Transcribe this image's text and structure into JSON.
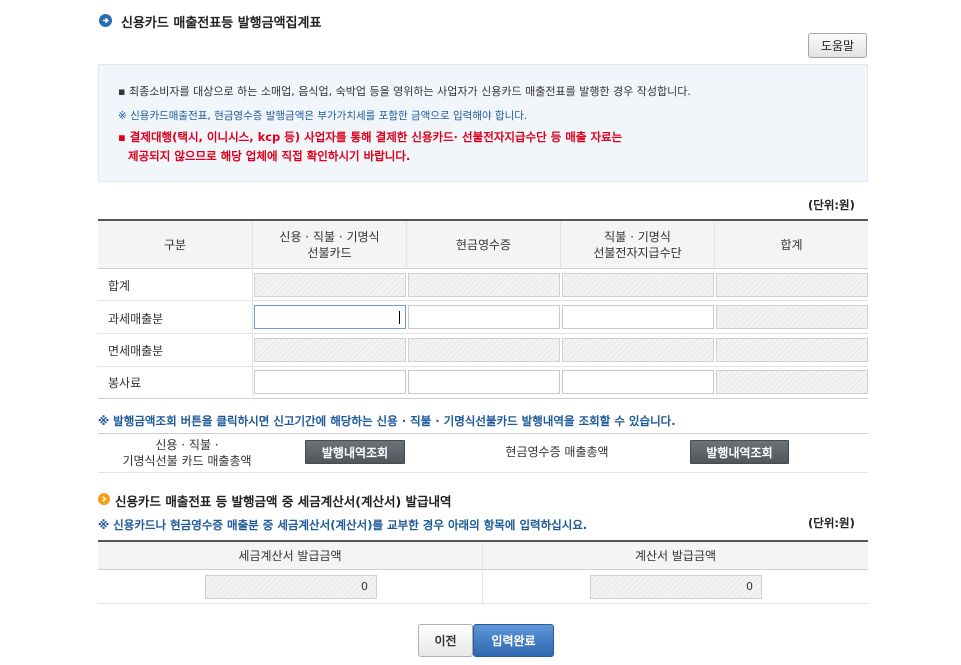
{
  "header": {
    "title": "신용카드 매출전표등 발행금액집계표",
    "help_label": "도움말",
    "title_icon": "arrow-right-icon"
  },
  "notice": {
    "line1": "▪ 최종소비자를 대상으로 하는 소매업, 음식업, 숙박업 등을 영위하는 사업자가 신용카드 매출전표를 발행한 경우 작성합니다.",
    "line2": "※ 신용카드매출전표, 현금영수증 발행금액은 부가가치세를 포함한 금액으로 입력해야 합니다.",
    "line3a": "▪ 결제대행(택시, 이니시스, kcp 등) 사업자를 통해 결제한 신용카드∙ 선불전자지급수단 등 매출 자료는",
    "line3b": "제공되지 않으므로 해당 업체에 직접 확인하시기 바랍니다."
  },
  "unit_label": "(단위:원)",
  "table": {
    "headers": {
      "category": "구분",
      "credit_line1": "신용 · 직불 · 기명식",
      "credit_line2": "선불카드",
      "cash": "현금영수증",
      "prepaid_line1": "직불 · 기명식",
      "prepaid_line2": "선불전자지급수단",
      "total": "합계"
    },
    "rows": [
      {
        "label": "합계"
      },
      {
        "label": "과세매출분"
      },
      {
        "label": "면세매출분"
      },
      {
        "label": "봉사료"
      }
    ]
  },
  "lookup": {
    "note": "※ 발행금액조회 버튼을 클릭하시면 신고기간에 해당하는 신용 · 직불 · 기명식선불카드 발행내역을 조회할 수 있습니다.",
    "card_label_line1": "신용 · 직불 ·",
    "card_label_line2": "기명식선불 카드 매출총액",
    "card_button": "발행내역조회",
    "cash_label": "현금영수증 매출총액",
    "cash_button": "발행내역조회"
  },
  "section2": {
    "title": "신용카드 매출전표 등 발행금액 중 세금계산서(계산서) 발급내역",
    "note": "※ 신용카드나 현금영수증 매출분 중 세금계산서(계산서)를 교부한 경우 아래의 항목에 입력하십시요.",
    "unit_label": "(단위:원)",
    "tax_invoice_header": "세금계산서 발급금액",
    "invoice_header": "계산서 발급금액",
    "tax_invoice_value": "0",
    "invoice_value": "0"
  },
  "footer": {
    "prev_label": "이전",
    "done_label": "입력완료"
  },
  "colors": {
    "accent_blue": "#2a6bb5",
    "notice_red": "#e0001b",
    "note_blue": "#1e5a99",
    "section_orange": "#f2a01a"
  }
}
